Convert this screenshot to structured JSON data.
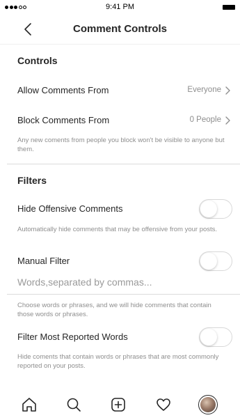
{
  "status_bar": {
    "time": "9:41 PM"
  },
  "nav": {
    "title": "Comment Controls"
  },
  "controls": {
    "header": "Controls",
    "allow_comments": {
      "label": "Allow Comments From",
      "value": "Everyone"
    },
    "block_comments": {
      "label": "Block Comments From",
      "value": "0 People"
    },
    "block_helper": "Any new coments from people you block won't be visible to anyone but them."
  },
  "filters": {
    "header": "Filters",
    "hide_offensive": {
      "label": "Hide Offensive Comments",
      "enabled": false
    },
    "hide_offensive_helper": "Automatically hide comments that may be offensive from your posts.",
    "manual_filter": {
      "label": "Manual Filter",
      "enabled": false
    },
    "manual_filter_placeholder": "Words,separated by commas...",
    "manual_filter_helper": "Choose words or phrases, and we will hide comments that contain those words or phrases.",
    "most_reported": {
      "label": "Filter Most Reported Words",
      "enabled": false
    },
    "most_reported_helper": "Hide coments that contain words or phrases that are most commonly reported on your posts."
  },
  "tab_bar": {
    "items": [
      "home-icon",
      "search-icon",
      "add-post-icon",
      "heart-icon",
      "profile-avatar"
    ]
  },
  "colors": {
    "text": "#262626",
    "secondary": "#8e8e8e",
    "divider": "#dbdbdb"
  }
}
